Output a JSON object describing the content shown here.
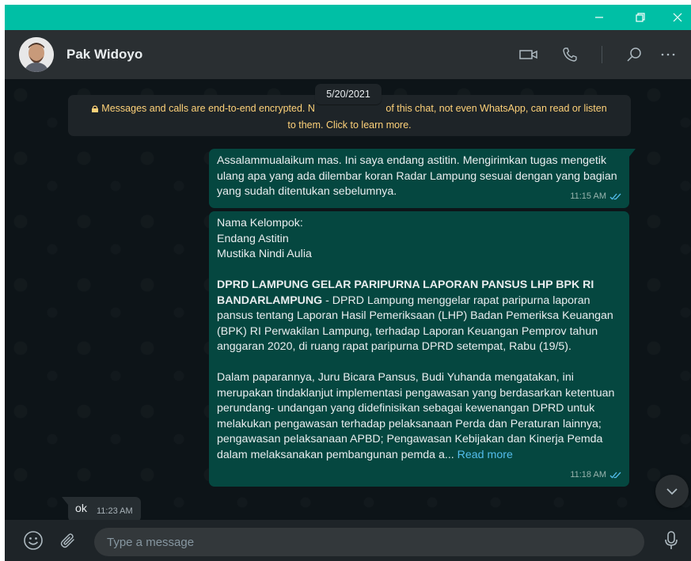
{
  "window": {
    "accent_color": "#00bfa5",
    "controls": [
      "minimize-icon",
      "restore-icon",
      "close-icon"
    ]
  },
  "header": {
    "contact_name": "Pak Widoyo",
    "icons": [
      "video-call-icon",
      "voice-call-icon",
      "search-icon",
      "more-icon"
    ]
  },
  "chat": {
    "date": "5/20/2021",
    "encryption_notice_line1": "Messages and calls are end-to-end encrypted. N",
    "encryption_notice_line1b": " of this chat, not even WhatsApp, can read or listen",
    "encryption_notice_line2": "to them. Click to learn more.",
    "messages": [
      {
        "direction": "outgoing",
        "text": "Assalammualaikum mas. Ini saya endang astitin. Mengirimkan tugas mengetik ulang apa yang ada dilembar koran Radar Lampung sesuai dengan yang bagian yang sudah ditentukan sebelumnya.",
        "time": "11:15 AM",
        "status": "read"
      },
      {
        "direction": "outgoing",
        "line1": "Nama Kelompok:",
        "line2": "Endang Astitin",
        "line3": "Mustika Nindi Aulia",
        "headline": " DPRD LAMPUNG GELAR PARIPURNA LAPORAN PANSUS LHP BPK RI BANDARLAMPUNG",
        "para1": " - DPRD Lampung menggelar rapat paripurna laporan pansus tentang Laporan Hasil Pemeriksaan (LHP) Badan Pemeriksa Keuangan (BPK) RI Perwakilan Lampung, terhadap Laporan Keuangan Pemprov tahun anggaran 2020, di ruang rapat paripurna DPRD setempat, Rabu (19/5).",
        "para2": "Dalam paparannya, Juru Bicara Pansus, Budi Yuhanda mengatakan, ini merupakan tindaklanjut implementasi pengawasan yang berdasarkan ketentuan perundang- undangan yang didefinisikan sebagai kewenangan DPRD untuk melakukan pengawasan terhadap pelaksanaan Perda dan Peraturan lainnya; pengawasan pelaksanaan APBD; Pengawasan Kebijakan dan Kinerja Pemda dalam melaksanakan pembangunan pemda a... ",
        "read_more": "Read more",
        "time": "11:18 AM",
        "status": "read"
      },
      {
        "direction": "incoming",
        "text": "ok",
        "time": "11:23 AM"
      }
    ]
  },
  "composer": {
    "placeholder": "Type a message",
    "icons": [
      "emoji-icon",
      "attach-icon",
      "microphone-icon"
    ]
  }
}
